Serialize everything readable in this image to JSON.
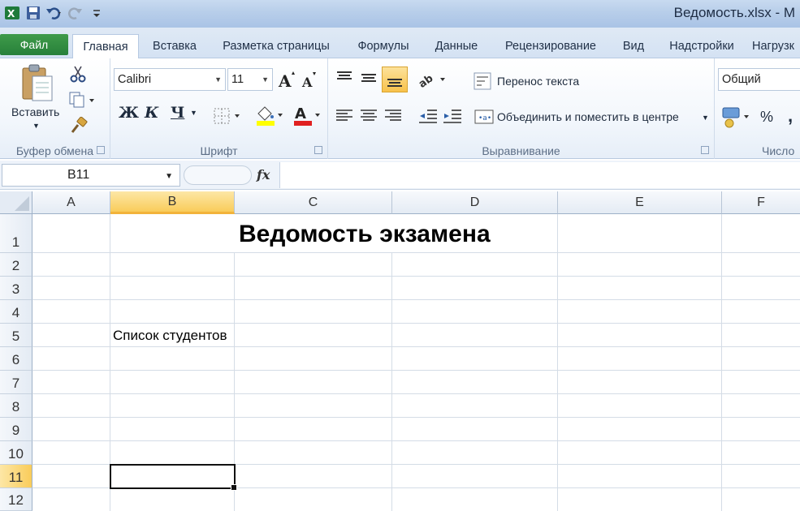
{
  "window": {
    "title": "Ведомость.xlsx - M"
  },
  "tabs": {
    "file": "Файл",
    "items": [
      "Главная",
      "Вставка",
      "Разметка страницы",
      "Формулы",
      "Данные",
      "Рецензирование",
      "Вид",
      "Надстройки",
      "Нагрузк"
    ],
    "active": "Главная"
  },
  "ribbon": {
    "clipboard": {
      "label": "Буфер обмена",
      "paste": "Вставить"
    },
    "font": {
      "label": "Шрифт",
      "name": "Calibri",
      "size": "11",
      "bold": "Ж",
      "italic": "К",
      "underline": "Ч"
    },
    "alignment": {
      "label": "Выравнивание",
      "wrap": "Перенос текста",
      "merge": "Объединить и поместить в центре"
    },
    "number": {
      "label": "Число",
      "format": "Общий",
      "percent": "%",
      "comma": ","
    }
  },
  "formula_bar": {
    "name_box": "B11",
    "fx": "fx",
    "formula": ""
  },
  "sheet": {
    "columns": [
      "A",
      "B",
      "C",
      "D",
      "E",
      "F"
    ],
    "rows": [
      "1",
      "2",
      "3",
      "4",
      "5",
      "6",
      "7",
      "8",
      "9",
      "10",
      "11",
      "12"
    ],
    "selected_cell": "B11",
    "cells": {
      "C1": "Ведомость экзамена",
      "B5": "Список студентов"
    }
  },
  "colors": {
    "file_tab": "#2f8a3f",
    "selection_header": "#f9cc5a",
    "font_color_bar": "#e02020",
    "highlight_bar": "#ffff00"
  }
}
